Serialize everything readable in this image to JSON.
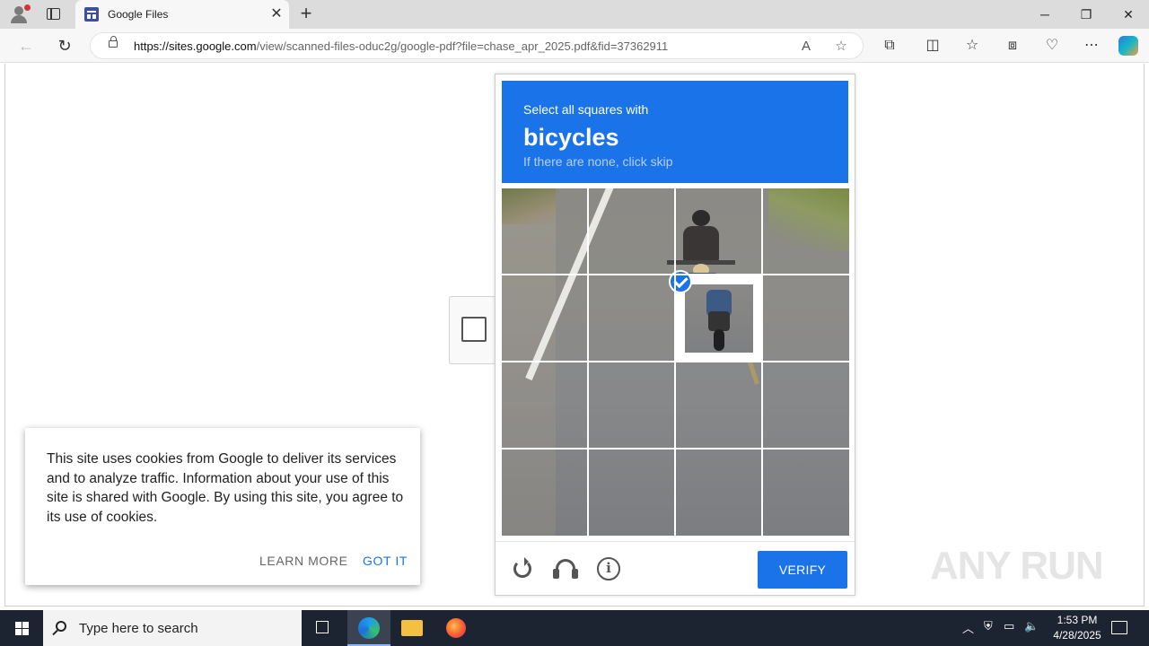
{
  "browser": {
    "tab_title": "Google Files",
    "tab_close": "✕",
    "new_tab": "+",
    "window": {
      "minimize": "─",
      "restore": "❐",
      "close": "✕"
    },
    "url_host": "https://sites.google.com",
    "url_path": "/view/scanned-files-oduc2g/google-pdf?file=chase_apr_2025.pdf&fid=37362911"
  },
  "captcha": {
    "instruction_line1": "Select all squares with",
    "target": "bicycles",
    "instruction_line3": "If there are none, click skip",
    "grid": {
      "rows": 4,
      "cols": 4,
      "selected_cells": [
        [
          1,
          2
        ]
      ]
    },
    "verify_label": "VERIFY",
    "header_color": "#1a73e8",
    "icons": [
      "reload-icon",
      "headphones-icon",
      "info-icon"
    ]
  },
  "cookie_banner": {
    "text": "This site uses cookies from Google to deliver its services and to analyze traffic. Information about your use of this site is shared with Google. By using this site, you agree to its use of cookies.",
    "learn_more": "LEARN MORE",
    "got_it": "GOT IT"
  },
  "watermark": "ANY RUN",
  "taskbar": {
    "search_placeholder": "Type here to search",
    "time": "1:53 PM",
    "date": "4/28/2025"
  }
}
